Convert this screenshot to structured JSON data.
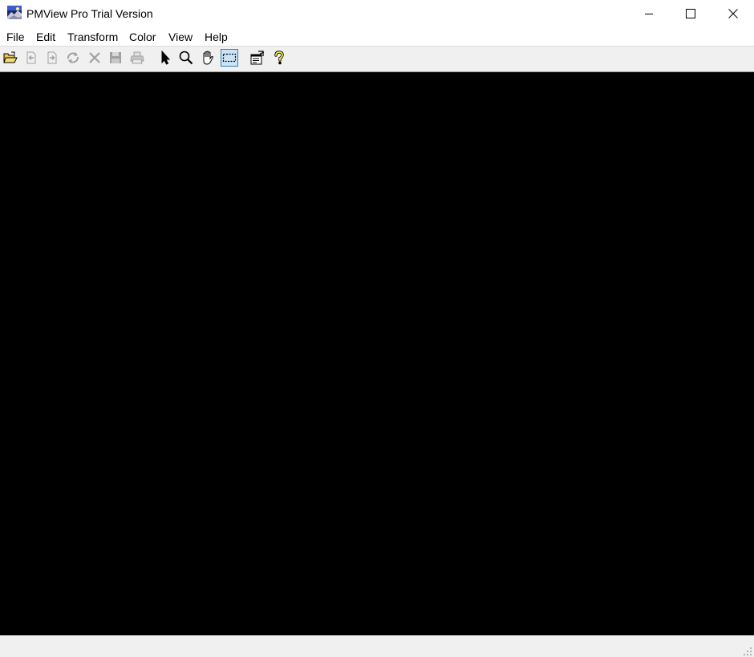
{
  "window": {
    "title": "PMView Pro Trial Version",
    "icon": "pmview-app-icon",
    "controls": {
      "minimize_icon": "minimize-icon",
      "maximize_icon": "maximize-icon",
      "close_icon": "close-icon"
    }
  },
  "menubar": {
    "items": [
      "File",
      "Edit",
      "Transform",
      "Color",
      "View",
      "Help"
    ]
  },
  "toolbar": {
    "buttons": [
      {
        "icon": "open-folder-icon",
        "enabled": true
      },
      {
        "icon": "previous-image-icon",
        "enabled": false
      },
      {
        "icon": "next-image-icon",
        "enabled": false
      },
      {
        "icon": "refresh-icon",
        "enabled": false
      },
      {
        "icon": "delete-icon",
        "enabled": false
      },
      {
        "icon": "save-icon",
        "enabled": false
      },
      {
        "icon": "print-icon",
        "enabled": false
      },
      {
        "icon": "pointer-arrow-icon",
        "enabled": true
      },
      {
        "icon": "magnifier-icon",
        "enabled": true
      },
      {
        "icon": "hand-pan-icon",
        "enabled": true
      },
      {
        "icon": "rectangle-select-icon",
        "enabled": true,
        "active": true
      },
      {
        "icon": "properties-icon",
        "enabled": true
      },
      {
        "icon": "help-question-icon",
        "enabled": true
      }
    ]
  },
  "canvas": {
    "background": "#000000"
  },
  "statusbar": {
    "text": ""
  },
  "colors": {
    "toolbar_bg": "#f0f0f0",
    "active_tool_bg": "#cce4f7",
    "active_tool_border": "#3c7fb1",
    "disabled_icon": "#a0a0a0"
  }
}
